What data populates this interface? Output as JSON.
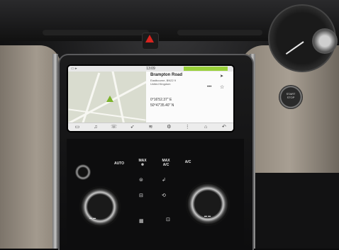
{
  "screen": {
    "status_time": "13:09",
    "place_title": "Brampton Road",
    "place_sub1": "Eastbourne, BN22 9",
    "place_sub2": "United Kingdom",
    "coord_1": "0°16'52.37\" E",
    "coord_2": "50°47'35.40\" N",
    "more_label": "•••",
    "star_glyph": "☆",
    "nav_glyph": "➤"
  },
  "climate": {
    "auto": "AUTO",
    "max_top": "MAX",
    "max_sub": "❄",
    "max_ac_top": "MAX",
    "max_ac_sub": "A/C",
    "ac": "A/C"
  },
  "start_button": {
    "line1": "START",
    "line2": "STOP"
  },
  "colors": {
    "accent_green": "#9ad13a",
    "hazard_red": "#d8241f"
  },
  "icons": [
    "car-icon",
    "media-icon",
    "phone-icon",
    "navigation-icon",
    "climate-icon",
    "settings-icon",
    "apps-icon",
    "home-icon",
    "back-icon"
  ]
}
